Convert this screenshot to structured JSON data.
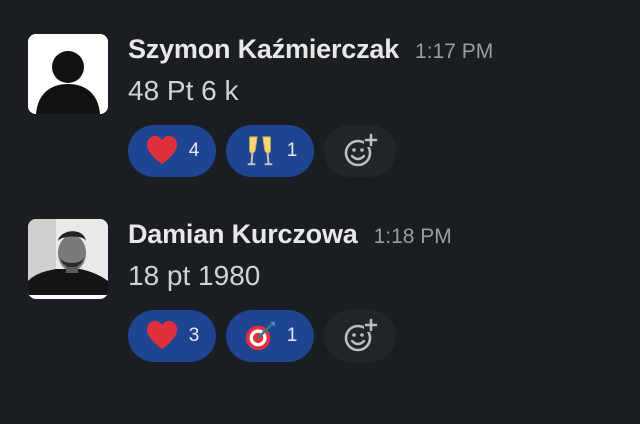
{
  "messages": [
    {
      "author": "Szymon Kaźmierczak",
      "timestamp": "1:17 PM",
      "text": "48 Pt 6 k",
      "avatar_icon": "default-user-avatar-icon",
      "reactions": [
        {
          "emoji_icon": "red-heart-icon",
          "count": "4"
        },
        {
          "emoji_icon": "champagne-glasses-icon",
          "count": "1"
        }
      ]
    },
    {
      "author": "Damian Kurczowa",
      "timestamp": "1:18 PM",
      "text": "18 pt 1980",
      "avatar_icon": "user-photo-avatar",
      "reactions": [
        {
          "emoji_icon": "red-heart-icon",
          "count": "3"
        },
        {
          "emoji_icon": "direct-hit-target-icon",
          "count": "1"
        }
      ]
    }
  ],
  "add_reaction_icon": "add-reaction-icon",
  "colors": {
    "background": "#1a1d21",
    "reaction_bg": "#1f4592",
    "add_reaction_bg": "#222529",
    "author": "#e8e8e8",
    "timestamp": "#9b9c9e",
    "text": "#d1d2d3"
  }
}
